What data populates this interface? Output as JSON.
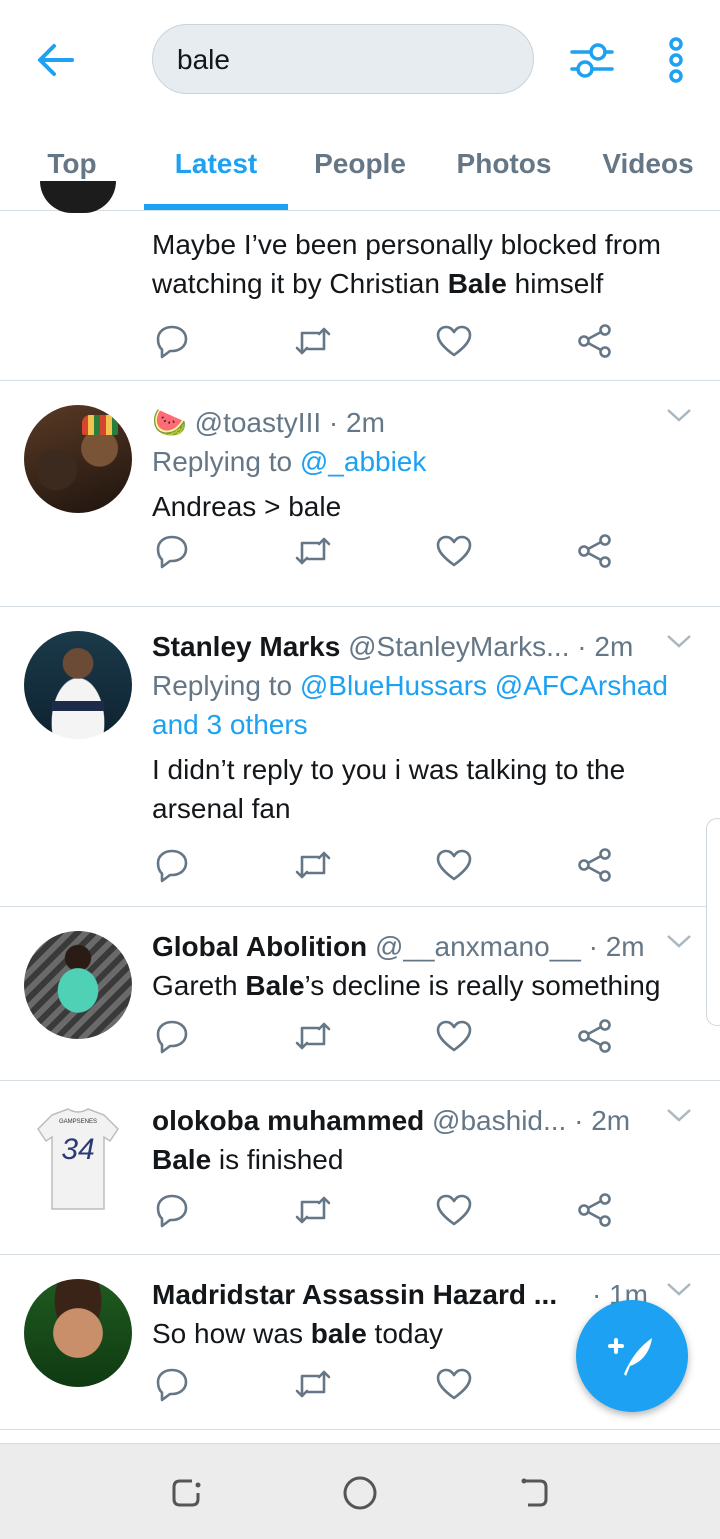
{
  "search": {
    "query": "bale"
  },
  "tabs": [
    {
      "label": "Top"
    },
    {
      "label": "Latest"
    },
    {
      "label": "People"
    },
    {
      "label": "Photos"
    },
    {
      "label": "Videos"
    }
  ],
  "tweets": [
    {
      "text_before": "Maybe I’ve been personally blocked from",
      "text_line2_before": "watching it by Christian ",
      "bold": "Bale",
      "text_line2_after": " himself"
    },
    {
      "emoji": "🍉",
      "handle": "@toastyIII",
      "time": "· 2m",
      "replying_prefix": "Replying to ",
      "replying_to": "@_abbiek",
      "text": "Andreas > bale"
    },
    {
      "name": "Stanley Marks",
      "handle": "@StanleyMarks...",
      "time": "· 2m",
      "replying_prefix": "Replying to ",
      "replying_to": "@BlueHussars @AFCArshad",
      "replying_more": "and 3 others",
      "text_line1": "I didn’t reply to you i was talking to the",
      "text_line2": "arsenal fan"
    },
    {
      "name": "Global Abolition",
      "handle": "@__anxmano__",
      "time": "· 2m",
      "text_before": "Gareth ",
      "bold": "Bale",
      "text_after": "’s decline is really something"
    },
    {
      "name": "olokoba muhammed",
      "handle": "@bashid...",
      "time": "· 2m",
      "bold": "Bale",
      "text_after": " is finished",
      "jersey_number": "34",
      "jersey_text": "GAMPSENES"
    },
    {
      "name": "Madridstar Assassin Hazard ...",
      "time": "· 1m",
      "text_before": "So how was ",
      "bold": "bale",
      "text_after": " today"
    }
  ],
  "colors": {
    "accent": "#1da1f2",
    "text": "#14171a",
    "secondary": "#657786",
    "divider": "#d6dde3"
  },
  "icons": [
    "back-arrow-icon",
    "filter-icon",
    "more-vert-icon",
    "reply-icon",
    "retweet-icon",
    "like-icon",
    "share-icon",
    "chevron-down-icon",
    "compose-tweet-icon",
    "recent-apps-icon",
    "home-icon",
    "back-nav-icon"
  ]
}
